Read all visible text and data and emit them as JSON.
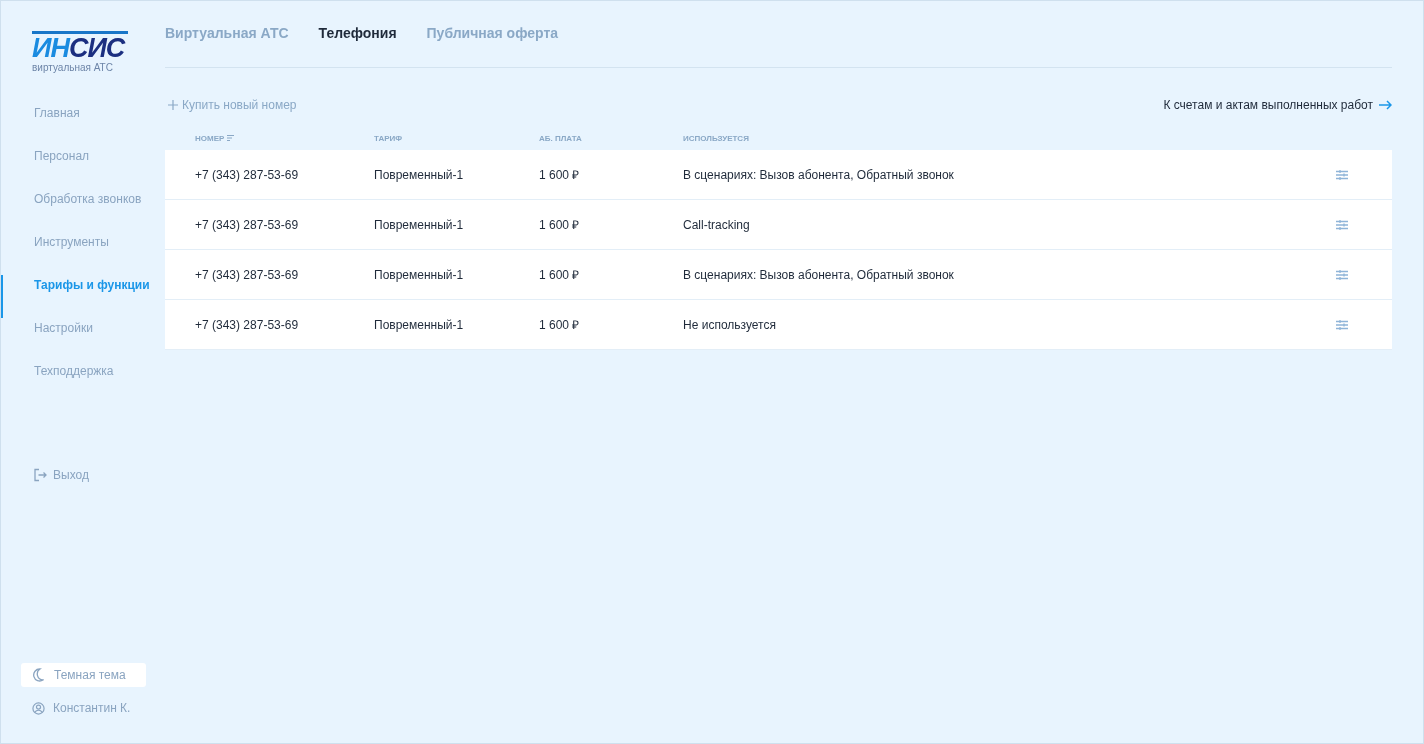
{
  "logo": {
    "part_1": "ИН",
    "part_2": "СИС",
    "subtitle": "виртуальная АТС"
  },
  "tabs": [
    {
      "label": "Виртуальная АТС",
      "selected": false
    },
    {
      "label": "Телефония",
      "selected": true
    },
    {
      "label": "Публичная оферта",
      "selected": false
    }
  ],
  "sidebar": {
    "items": [
      {
        "label": "Главная",
        "selected": false
      },
      {
        "label": "Персонал",
        "selected": false
      },
      {
        "label": "Обработка звонков",
        "selected": false
      },
      {
        "label": "Инструменты",
        "selected": false
      },
      {
        "label": "Тарифы и функции",
        "selected": true
      },
      {
        "label": "Настройки",
        "selected": false
      },
      {
        "label": "Техподдержка",
        "selected": false
      }
    ],
    "logout": "Выход",
    "theme_toggle": "Темная тема",
    "user": "Константин К."
  },
  "toolbar": {
    "buy_number": "Купить новый номер",
    "invoices_link": "К счетам и актам выполненных работ"
  },
  "table": {
    "columns": [
      {
        "label": "НОМЕР",
        "sortable": true
      },
      {
        "label": "ТАРИФ",
        "sortable": false
      },
      {
        "label": "АБ. ПЛАТА",
        "sortable": false
      },
      {
        "label": "ИСПОЛЬЗУЕТСЯ",
        "sortable": false
      }
    ],
    "rows": [
      {
        "number": "+7 (343) 287-53-69",
        "tariff": "Повременный-1",
        "fee": "1 600 ₽",
        "usage": "В сценариях: Вызов абонента, Обратный звонок"
      },
      {
        "number": "+7 (343) 287-53-69",
        "tariff": "Повременный-1",
        "fee": "1 600 ₽",
        "usage": "Call-tracking"
      },
      {
        "number": "+7 (343) 287-53-69",
        "tariff": "Повременный-1",
        "fee": "1 600 ₽",
        "usage": "В сценариях: Вызов абонента, Обратный звонок"
      },
      {
        "number": "+7 (343) 287-53-69",
        "tariff": "Повременный-1",
        "fee": "1 600 ₽",
        "usage": "Не используется"
      }
    ]
  }
}
